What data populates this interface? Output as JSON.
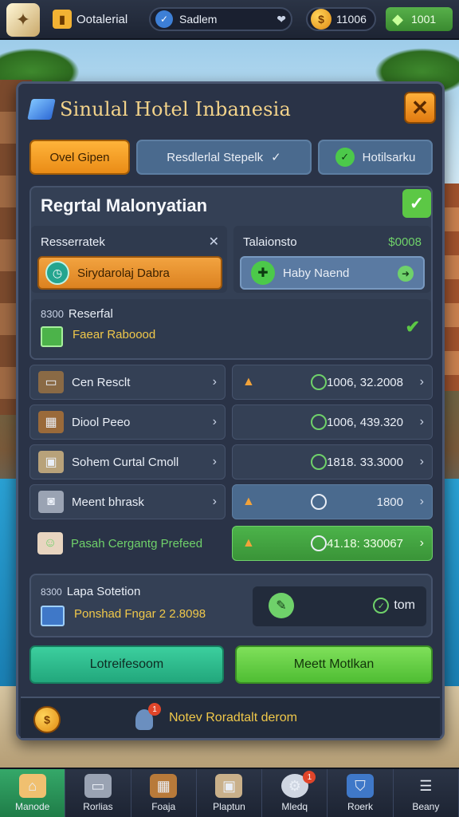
{
  "topbar": {
    "hotel_label": "Ootalerial",
    "season_label": "Sadlem",
    "coins": "11006",
    "gems": "1001"
  },
  "panel": {
    "title": "Sinulal Hotel  Inbanesia",
    "tabs": [
      {
        "label": "Ovel Gipen"
      },
      {
        "label": "Resdlerlal Stepelk"
      },
      {
        "label": "Hotilsarku"
      }
    ]
  },
  "section": {
    "title": "Regrtal Malonyatian",
    "left": {
      "label": "Resserratek",
      "button": "Sirydarolaj Dabra"
    },
    "right": {
      "label": "Talaionsto",
      "value": "$0008",
      "button": "Haby Naend"
    },
    "reserve": {
      "prefix": "8300",
      "label": "Reserfal",
      "sub": "Faear Raboood"
    }
  },
  "items": [
    {
      "label": "Cen Resclt",
      "value": "1006, 32.2008"
    },
    {
      "label": "Diool Peeo",
      "value": "1006, 439.320"
    },
    {
      "label": "Sohem Curtal Cmoll",
      "value": "1818. 33.3000"
    },
    {
      "label": "Meent bhrask",
      "value": "1800"
    },
    {
      "label": "Pasah Cergantg Prefeed",
      "value": "41.18: 330067"
    }
  ],
  "promo": {
    "prefix": "8300",
    "label": "Lapa Sotetion",
    "sub": "Ponshad Fngar 2 2.8098",
    "box_text": "tom"
  },
  "buttons": {
    "left": "Lotreifesoom",
    "right": "Meett Motlkan"
  },
  "footer": {
    "badge": "1",
    "text": "Notev Roradtalt derom"
  },
  "bottomnav": [
    {
      "label": "Manode"
    },
    {
      "label": "Rorlias"
    },
    {
      "label": "Foaja"
    },
    {
      "label": "Plaptun"
    },
    {
      "label": "Mledq",
      "badge": "1"
    },
    {
      "label": "Roerk"
    },
    {
      "label": "Beany"
    }
  ]
}
